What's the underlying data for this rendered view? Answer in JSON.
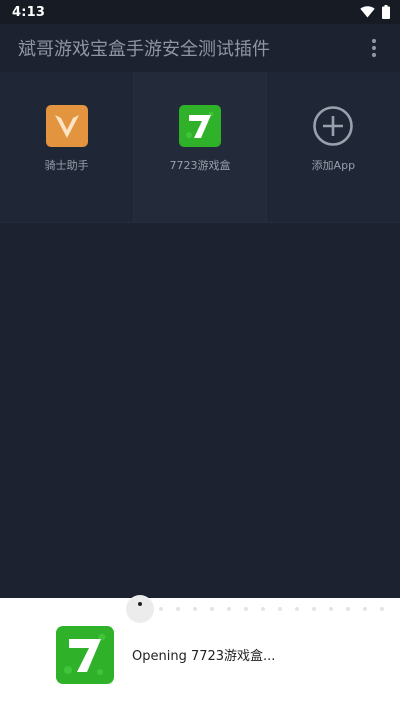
{
  "status_bar": {
    "time": "4:13"
  },
  "app_bar": {
    "title": "斌哥游戏宝盒手游安全测试插件",
    "menu_icon": "more-vert-icon"
  },
  "grid": {
    "items": [
      {
        "label": "骑士助手",
        "icon": "knight-assistant-icon"
      },
      {
        "label": "7723游戏盒",
        "icon": "app-7723-icon"
      },
      {
        "label": "添加App",
        "icon": "add-circle-icon"
      }
    ]
  },
  "loading_sheet": {
    "text": "Opening 7723游戏盒...",
    "icon": "app-7723-icon"
  },
  "colors": {
    "background": "#1c2230",
    "title_text": "#8f96a3",
    "icon_orange": "#e3943e",
    "icon_green": "#2fb12a",
    "sheet_background": "#ffffff"
  }
}
